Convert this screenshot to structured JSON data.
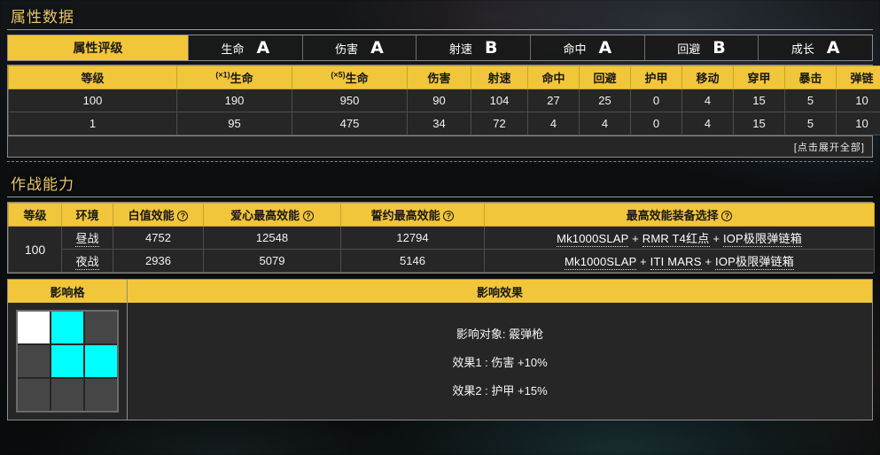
{
  "attributes_section": {
    "title": "属性数据",
    "rating_bar": {
      "active_label": "属性评级",
      "ratings": [
        {
          "label": "生命",
          "grade": "A"
        },
        {
          "label": "伤害",
          "grade": "A"
        },
        {
          "label": "射速",
          "grade": "B"
        },
        {
          "label": "命中",
          "grade": "A"
        },
        {
          "label": "回避",
          "grade": "B"
        },
        {
          "label": "成长",
          "grade": "A"
        }
      ]
    },
    "stats_table": {
      "headers": [
        "等级",
        "(×1)生命",
        "(×5)生命",
        "伤害",
        "射速",
        "命中",
        "回避",
        "护甲",
        "移动",
        "穿甲",
        "暴击",
        "弹链"
      ],
      "header_sup": [
        "",
        "(×1)",
        "(×5)",
        "",
        "",
        "",
        "",
        "",
        "",
        "",
        "",
        ""
      ],
      "header_main": [
        "等级",
        "生命",
        "生命",
        "伤害",
        "射速",
        "命中",
        "回避",
        "护甲",
        "移动",
        "穿甲",
        "暴击",
        "弹链"
      ],
      "rows": [
        [
          "100",
          "190",
          "950",
          "90",
          "104",
          "27",
          "25",
          "0",
          "4",
          "15",
          "5",
          "10"
        ],
        [
          "1",
          "95",
          "475",
          "34",
          "72",
          "4",
          "4",
          "0",
          "4",
          "15",
          "5",
          "10"
        ]
      ]
    },
    "expand_all_label": "[点击展开全部]"
  },
  "combat_section": {
    "title": "作战能力",
    "headers": {
      "level": "等级",
      "environment": "环境",
      "base_effect": "白值效能",
      "love_max": "爱心最高效能",
      "oath_max": "誓约最高效能",
      "best_gear": "最高效能装备选择",
      "help_icon": "?"
    },
    "level": "100",
    "rows": [
      {
        "environment": "昼战",
        "base_effect": "4752",
        "love_max": "12548",
        "oath_max": "12794",
        "gear": [
          "Mk1000SLAP",
          "RMR T4红点",
          "IOP极限弹链箱"
        ]
      },
      {
        "environment": "夜战",
        "base_effect": "2936",
        "love_max": "5079",
        "oath_max": "5146",
        "gear": [
          "Mk1000SLAP",
          "ITI MARS",
          "IOP极限弹链箱"
        ]
      }
    ],
    "gear_separator": "+"
  },
  "influence_section": {
    "grid_header": "影响格",
    "effect_header": "影响效果",
    "grid": [
      [
        "white",
        "cyan",
        "empty"
      ],
      [
        "empty",
        "cyan",
        "cyan"
      ],
      [
        "empty",
        "empty",
        "empty"
      ]
    ],
    "effects": [
      "影响对象: 霰弹枪",
      "效果1 : 伤害 +10%",
      "效果2 : 护甲 +15%"
    ]
  },
  "colors": {
    "accent_yellow": "#f2c63a",
    "title_gold": "#e8c86a",
    "grid_cyan": "#00ffff",
    "grid_white": "#ffffff",
    "grid_empty": "#464646",
    "cell_bg": "#262626"
  }
}
